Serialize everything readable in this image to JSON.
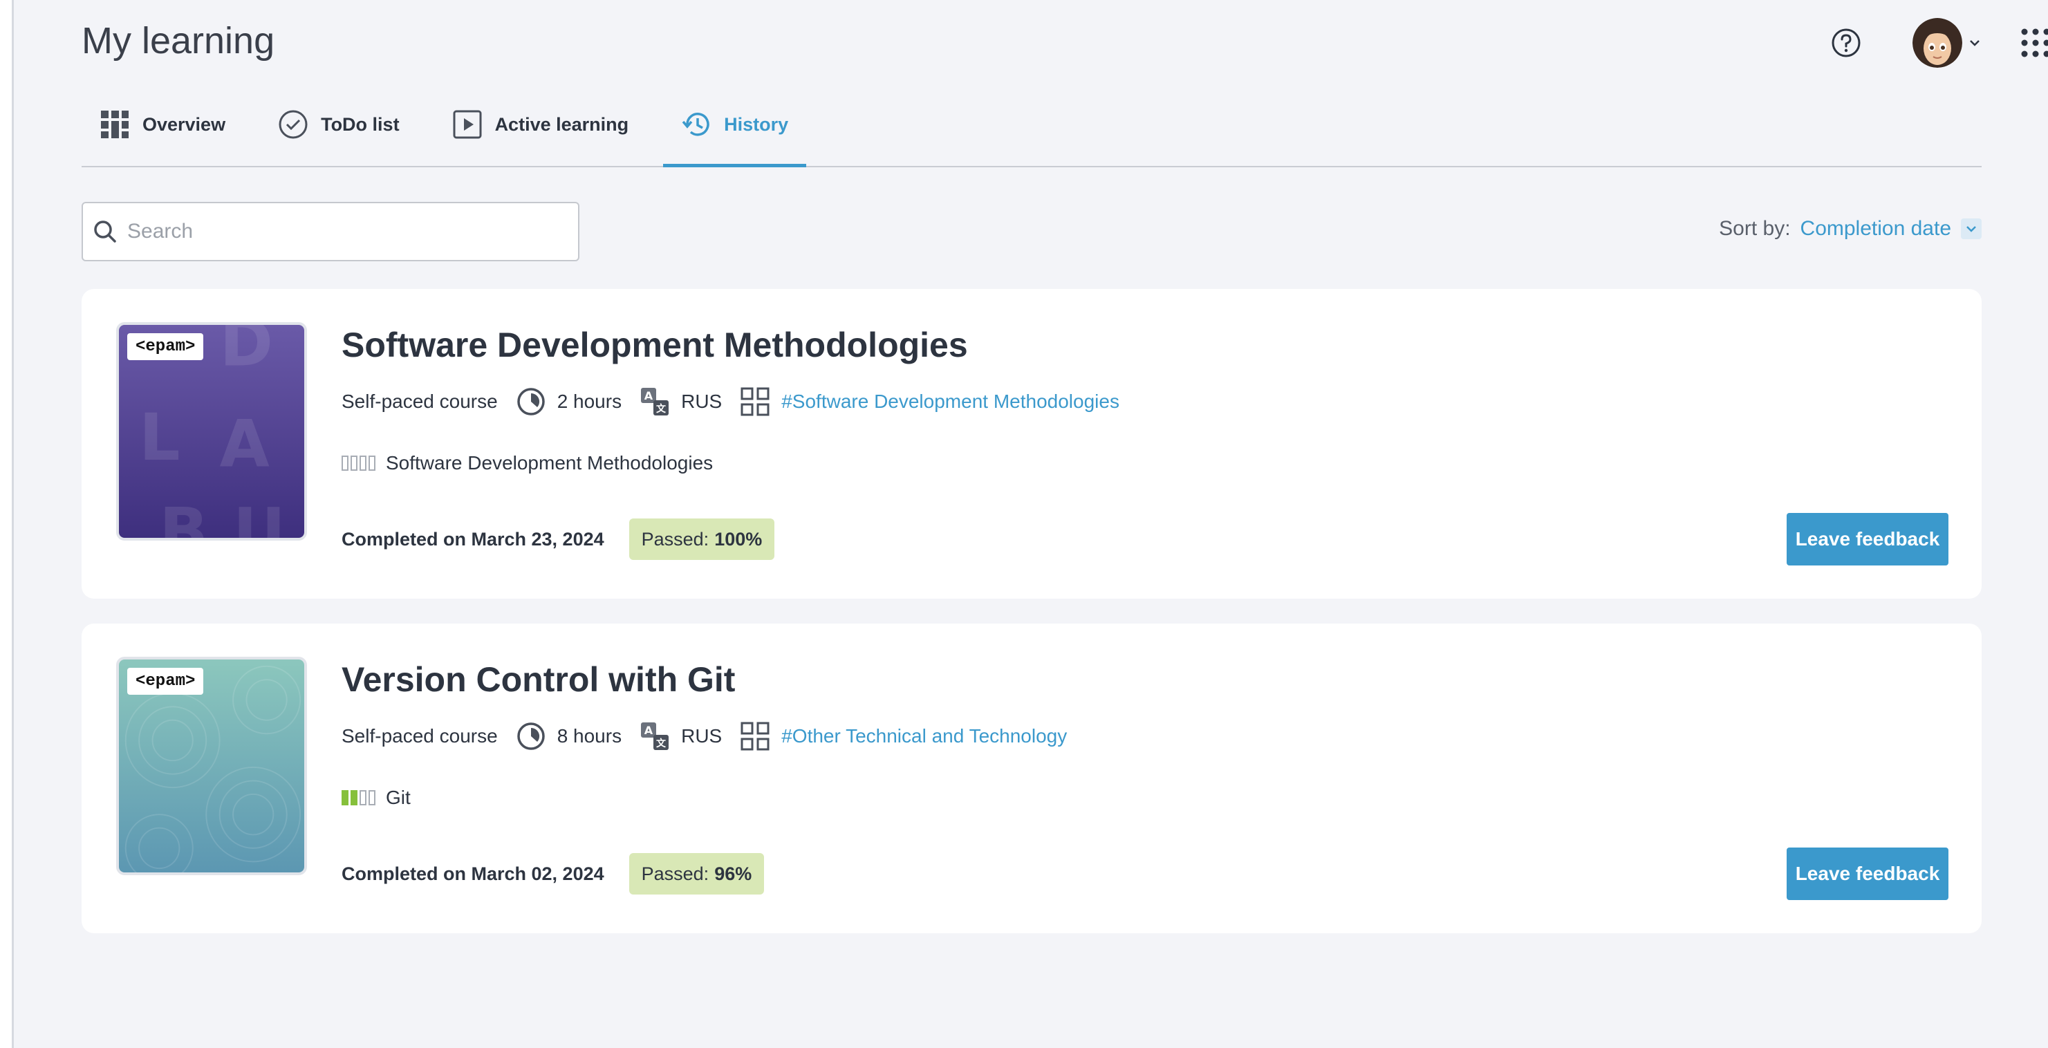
{
  "header": {
    "title": "My learning",
    "help_icon": "help-circle-icon",
    "avatar_icon": "user-avatar",
    "apps_icon": "apps-grid-icon"
  },
  "tabs": [
    {
      "label": "Overview",
      "icon": "grid-icon"
    },
    {
      "label": "ToDo list",
      "icon": "check-circle-icon"
    },
    {
      "label": "Active learning",
      "icon": "play-icon"
    },
    {
      "label": "History",
      "icon": "history-icon",
      "active": true
    }
  ],
  "search": {
    "placeholder": "Search",
    "value": ""
  },
  "sort": {
    "label": "Sort by:",
    "value": "Completion date"
  },
  "courses": [
    {
      "brand": "<epam>",
      "title": "Software Development Methodologies",
      "type": "Self-paced course",
      "duration": "2 hours",
      "language": "RUS",
      "tag": "#Software Development Methodologies",
      "skill": "Software Development Methodologies",
      "skill_level": 0,
      "completed": "Completed on March 23, 2024",
      "passed_label": "Passed:",
      "passed_value": "100%",
      "feedback_label": "Leave feedback"
    },
    {
      "brand": "<epam>",
      "title": "Version Control with Git",
      "type": "Self-paced course",
      "duration": "8 hours",
      "language": "RUS",
      "tag": "#Other Technical and Technology",
      "skill": "Git",
      "skill_level": 2,
      "completed": "Completed on March 02, 2024",
      "passed_label": "Passed:",
      "passed_value": "96%",
      "feedback_label": "Leave feedback"
    }
  ],
  "colors": {
    "accent": "#3b99cc",
    "passed_bg": "#d9e8b6",
    "skill_on": "#86c03b"
  }
}
